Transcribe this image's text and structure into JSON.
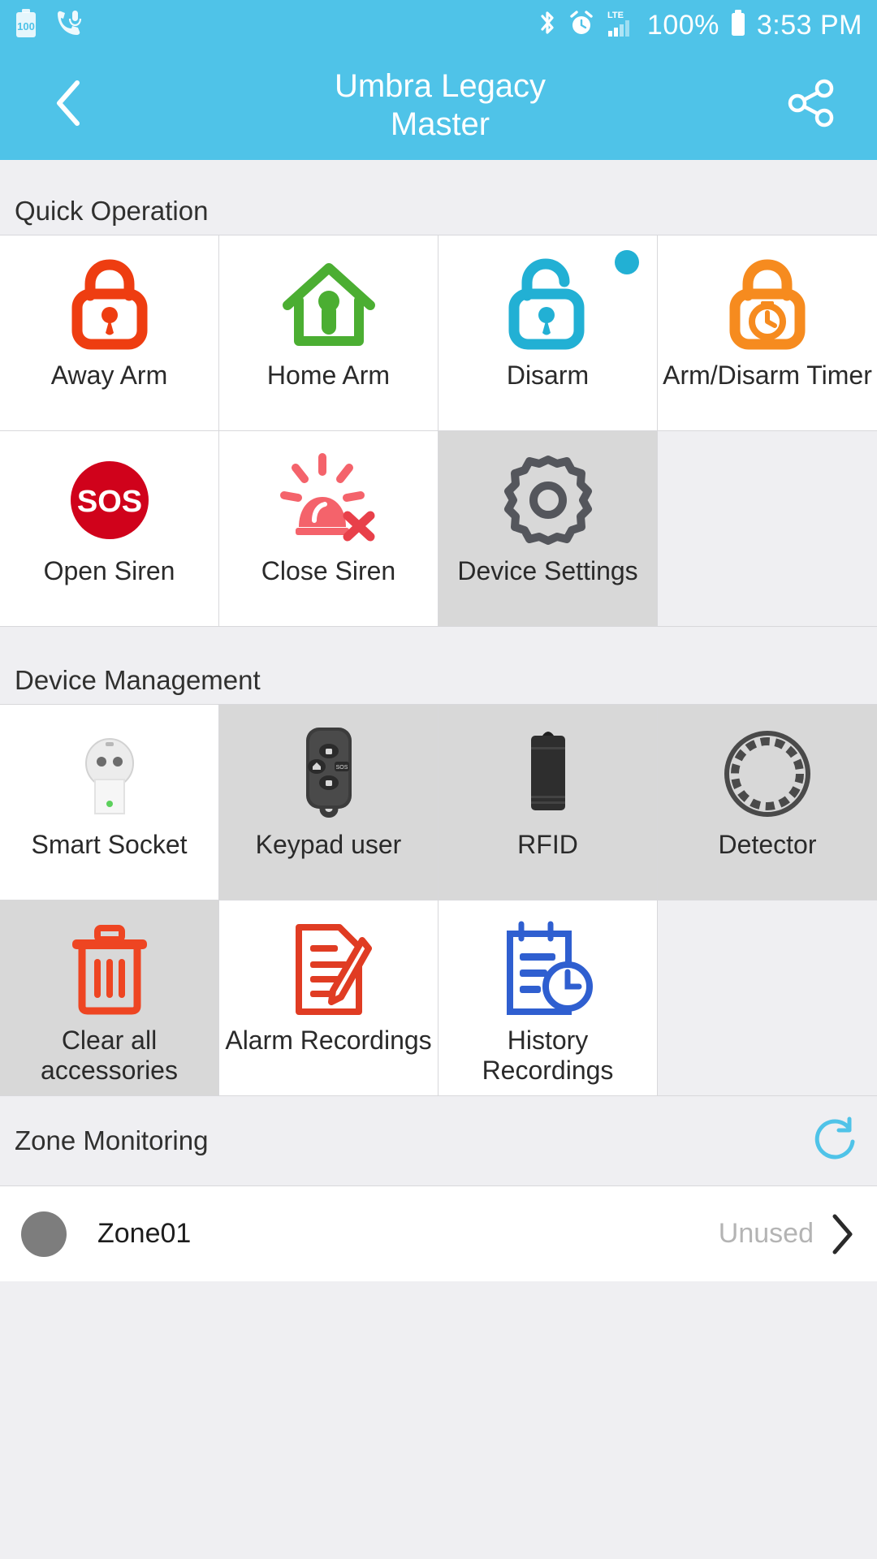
{
  "statusbar": {
    "battery_level_badge": "100",
    "battery_percent": "100%",
    "time": "3:53 PM",
    "icons": {
      "battery_saver": "battery-100-icon",
      "call_mic": "phone-mic-icon",
      "bluetooth": "bluetooth-icon",
      "alarm": "alarm-clock-icon",
      "network": "lte-signal-icon",
      "battery": "battery-icon"
    }
  },
  "header": {
    "title_line1": "Umbra Legacy",
    "title_line2": "Master",
    "back_icon": "back-chevron-icon",
    "share_icon": "share-icon"
  },
  "quick_operation": {
    "title": "Quick Operation",
    "tiles": [
      {
        "label": "Away Arm",
        "icon": "locked-padlock-icon",
        "color": "#EE3D11",
        "state": "normal",
        "badge": false
      },
      {
        "label": "Home Arm",
        "icon": "house-keyhole-icon",
        "color": "#4BAE32",
        "state": "normal",
        "badge": false
      },
      {
        "label": "Disarm",
        "icon": "unlocked-padlock-icon",
        "color": "#22B0D4",
        "state": "normal",
        "badge": true
      },
      {
        "label": "Arm/Disarm Timer",
        "icon": "timer-padlock-icon",
        "color": "#F68B1F",
        "state": "normal",
        "badge": false
      },
      {
        "label": "Open Siren",
        "icon": "sos-circle-icon",
        "color": "#D0021B",
        "state": "normal",
        "badge": false
      },
      {
        "label": "Close Siren",
        "icon": "siren-off-icon",
        "color": "#F4636B",
        "state": "normal",
        "badge": false
      },
      {
        "label": "Device Settings",
        "icon": "gear-icon",
        "color": "#54565C",
        "state": "pressed",
        "badge": false
      }
    ]
  },
  "device_management": {
    "title": "Device Management",
    "tiles": [
      {
        "label": "Smart Socket",
        "icon": "smart-socket-icon",
        "color": "#C9CBCD",
        "state": "normal"
      },
      {
        "label": "Keypad user",
        "icon": "remote-keyfob-icon",
        "color": "#3C3C3C",
        "state": "pressed"
      },
      {
        "label": "RFID",
        "icon": "rfid-tag-icon",
        "color": "#2E2E2E",
        "state": "pressed"
      },
      {
        "label": "Detector",
        "icon": "detector-ring-icon",
        "color": "#4A4A4A",
        "state": "pressed"
      },
      {
        "label": "Clear all accessories",
        "icon": "trash-can-icon",
        "color": "#EE4522",
        "state": "pressed"
      },
      {
        "label": "Alarm Recordings",
        "icon": "document-pen-icon",
        "color": "#E03C23",
        "state": "normal"
      },
      {
        "label": "History Recordings",
        "icon": "clipboard-clock-icon",
        "color": "#2F5FD0",
        "state": "normal"
      }
    ]
  },
  "zone_monitoring": {
    "title": "Zone Monitoring",
    "refresh_icon": "refresh-icon",
    "refresh_color": "#4FC3E8",
    "rows": [
      {
        "name": "Zone01",
        "status": "Unused",
        "dot_color": "#7D7D7D"
      }
    ]
  },
  "theme": {
    "accent": "#4FC3E8",
    "page_bg": "#EFEFF2",
    "tile_bg": "#FFFFFF",
    "tile_pressed_bg": "#D8D8D8",
    "divider": "#D8D8DB"
  }
}
